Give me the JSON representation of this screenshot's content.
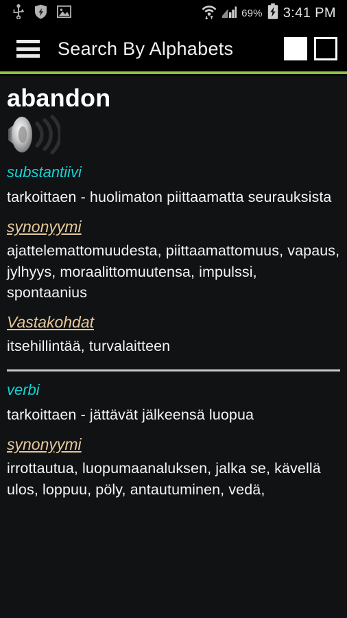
{
  "status_bar": {
    "left_icons": [
      {
        "name": "usb-icon",
        "label": "USB"
      },
      {
        "name": "shield-security-icon",
        "label": "Security"
      },
      {
        "name": "screenshot-image-icon",
        "label": "Screenshot"
      }
    ],
    "right_icons": [
      {
        "name": "wifi-icon",
        "label": "Wi-Fi"
      },
      {
        "name": "cellular-signal-icon",
        "label": "Signal"
      },
      {
        "name": "battery-charging-icon",
        "label": "Battery charging"
      }
    ],
    "battery_percent": "69%",
    "time": "3:41 PM"
  },
  "app_bar": {
    "menu_label": "Menu",
    "title": "Search By Alphabets",
    "action_filled_label": "Stop",
    "action_outline_label": "Record"
  },
  "colors": {
    "accent_rule": "#8ec540",
    "part_of_speech": "#11d5d5",
    "section_label": "#e8c89a",
    "body_text": "#f4f4f4",
    "card_background": "#101214",
    "page_background": "#000000"
  },
  "entry": {
    "headword": "abandon",
    "speaker_label": "Pronounce",
    "senses": [
      {
        "part_of_speech": "substantiivi",
        "definition": "tarkoittaen - huolimaton piittaamatta seurauksista",
        "groups": [
          {
            "label": "synonyymi",
            "text": "ajattelemattomuudesta, piittaamattomuus, vapaus, jylhyys, moraalittomuutensa, impulssi, spontaanius"
          },
          {
            "label": "Vastakohdat",
            "text": "itsehillintää, turvalaitteen"
          }
        ]
      },
      {
        "part_of_speech": "verbi",
        "definition": "tarkoittaen - jättävät jälkeensä luopua",
        "groups": [
          {
            "label": "synonyymi",
            "text": "irrottautua, luopumaanaluksen, jalka se, kävellä ulos, loppuu, pöly, antautuminen, vedä,"
          }
        ]
      }
    ]
  }
}
